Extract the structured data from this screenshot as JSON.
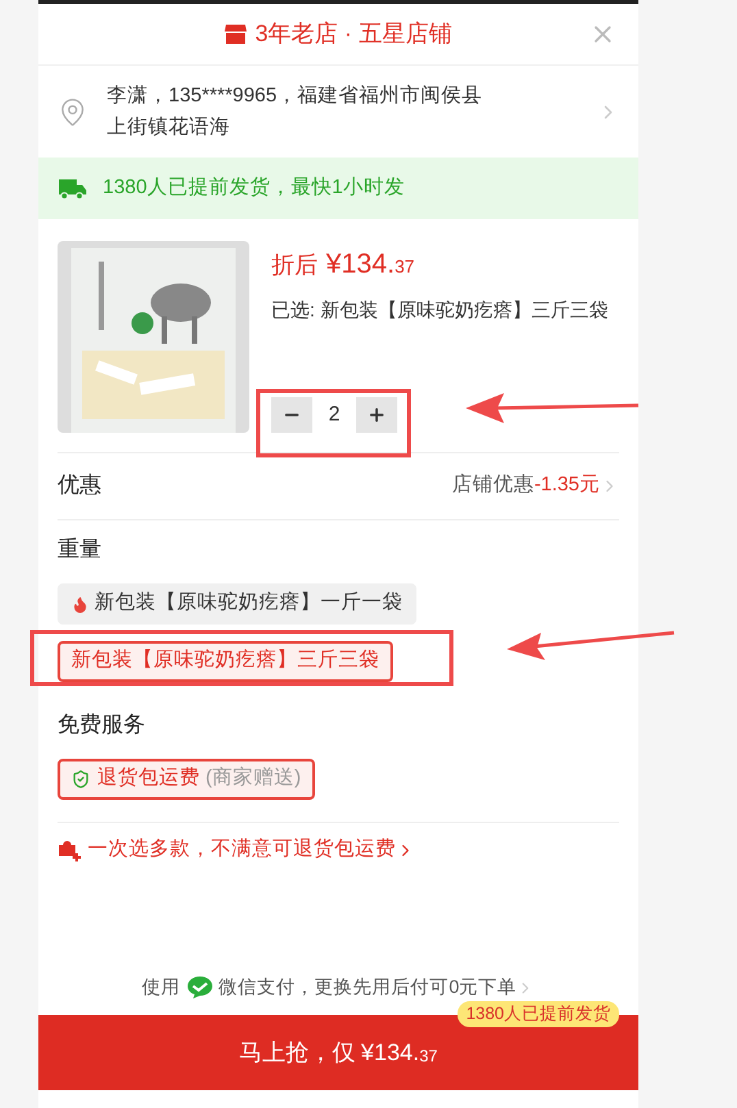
{
  "header": {
    "title": "3年老店 · 五星店铺"
  },
  "address": {
    "lines": [
      "李潇，135****9965，福建省福州市闽侯县",
      "上街镇花语海"
    ]
  },
  "shipping_banner": {
    "text": "1380人已提前发货，最快1小时发"
  },
  "product": {
    "price_prefix": "折后",
    "price_main": "¥134.",
    "price_cents": "37",
    "selected_text": "已选: 新包装【原味驼奶疙瘩】三斤三袋",
    "quantity": "2"
  },
  "discount": {
    "label": "优惠",
    "value": "店铺优惠",
    "amount": "-1.35元"
  },
  "weight": {
    "title": "重量",
    "options": [
      {
        "label": "新包装【原味驼奶疙瘩】一斤一袋",
        "selected": false,
        "hot": true
      },
      {
        "label": "新包装【原味驼奶疙瘩】三斤三袋",
        "selected": true,
        "hot": false
      }
    ]
  },
  "services": {
    "title": "免费服务",
    "items": [
      {
        "label": "退货包运费",
        "note": "(商家赠送)",
        "selected": true
      }
    ]
  },
  "promo": {
    "text": "一次选多款，不满意可退货包运费"
  },
  "payment": {
    "prefix": "使用",
    "text": "微信支付，更换先用后付可0元下单"
  },
  "buy_button": {
    "label": "马上抢，仅",
    "price_main": "¥134.",
    "price_cents": "37",
    "badge": "1380人已提前发货"
  }
}
